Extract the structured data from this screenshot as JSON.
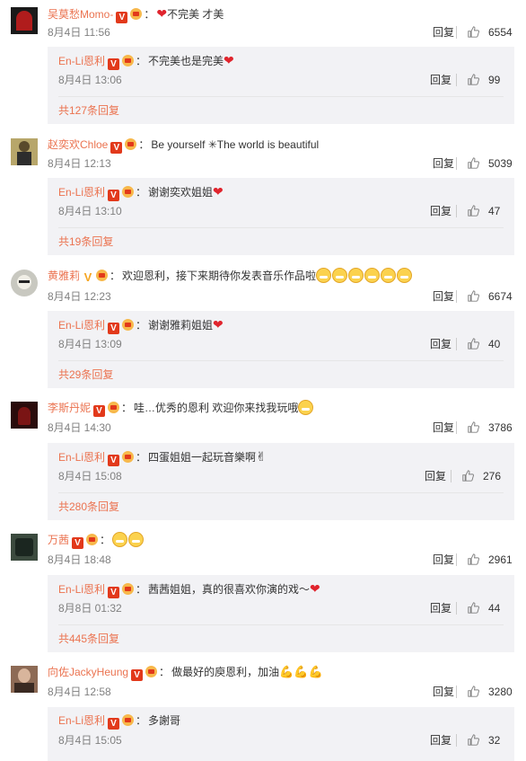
{
  "comments": [
    {
      "user": "吴莫愁Momo-",
      "badge_type": "v",
      "text": "不完美 才美",
      "time": "8月4日 11:56",
      "reply_label": "回复",
      "likes": "6554",
      "sub": {
        "user": "En-Li恩利",
        "text": "不完美也是完美",
        "time": "8月4日 13:06",
        "reply_label": "回复",
        "likes": "99",
        "more": "共127条回复"
      }
    },
    {
      "user": "赵奕欢Chloe",
      "badge_type": "v",
      "text": "Be yourself ✳The world is beautiful",
      "time": "8月4日 12:13",
      "reply_label": "回复",
      "likes": "5039",
      "sub": {
        "user": "En-Li恩利",
        "text": "谢谢奕欢姐姐",
        "time": "8月4日 13:10",
        "reply_label": "回复",
        "likes": "47",
        "more": "共19条回复"
      }
    },
    {
      "user": "黄雅莉",
      "badge_type": "vy",
      "text": "欢迎恩利，接下来期待你发表音乐作品啦",
      "time": "8月4日 12:23",
      "reply_label": "回复",
      "likes": "6674",
      "sub": {
        "user": "En-Li恩利",
        "text": "谢谢雅莉姐姐",
        "time": "8月4日 13:09",
        "reply_label": "回复",
        "likes": "40",
        "more": "共29条回复"
      }
    },
    {
      "user": "李斯丹妮",
      "badge_type": "v",
      "text": "哇…优秀的恩利 欢迎你来找我玩哦",
      "time": "8月4日 14:30",
      "reply_label": "回复",
      "likes": "3786",
      "sub": {
        "user": "En-Li恩利",
        "text": "四蛋姐姐一起玩音樂啊",
        "time": "8月4日 15:08",
        "reply_label": "回复",
        "likes": "276",
        "more": "共280条回复"
      }
    },
    {
      "user": "万茜",
      "badge_type": "v",
      "text": "",
      "time": "8月4日 18:48",
      "reply_label": "回复",
      "likes": "2961",
      "sub": {
        "user": "En-Li恩利",
        "text": "茜茜姐姐，真的很喜欢你演的戏～",
        "time": "8月8日 01:32",
        "reply_label": "回复",
        "likes": "44",
        "more": "共445条回复"
      }
    },
    {
      "user": "向佐JackyHeung",
      "badge_type": "v",
      "text": "做最好的庾恩利，加油",
      "time": "8月4日 12:58",
      "reply_label": "回复",
      "likes": "3280",
      "sub": {
        "user": "En-Li恩利",
        "text": "多謝哥",
        "time": "8月4日 15:05",
        "reply_label": "回复",
        "likes": "32",
        "more": ""
      }
    }
  ],
  "colors": {
    "username": "#eb7350",
    "time": "#808080",
    "subbox_bg": "#f2f2f5",
    "verified_badge": "#e2391b"
  },
  "icons": {
    "like": "thumbs-up-icon",
    "heart": "red-heart",
    "badge": "verified-v-icon",
    "vip": "vip-crown-icon"
  }
}
